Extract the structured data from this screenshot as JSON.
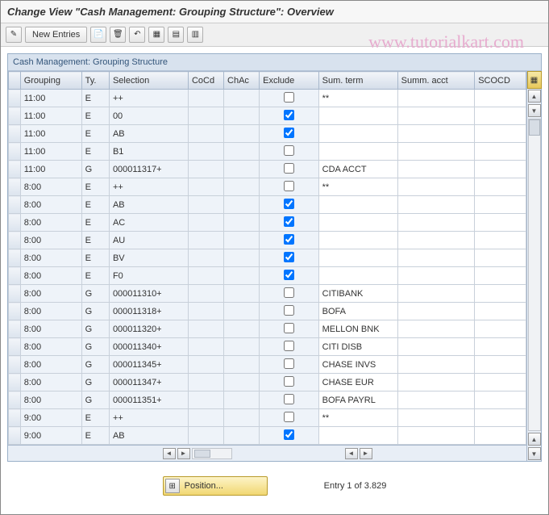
{
  "title": "Change View \"Cash Management: Grouping Structure\": Overview",
  "toolbar": {
    "new_entries_label": "New Entries"
  },
  "watermark": "www.tutorialkart.com",
  "panel_title": "Cash Management: Grouping Structure",
  "columns": {
    "grouping": "Grouping",
    "ty": "Ty.",
    "selection": "Selection",
    "cocd": "CoCd",
    "chac": "ChAc",
    "exclude": "Exclude",
    "sumterm": "Sum. term",
    "summacct": "Summ. acct",
    "scocd": "SCOCD"
  },
  "rows": [
    {
      "grouping": "11:00",
      "ty": "E",
      "selection": "++",
      "cocd": "",
      "chac": "",
      "exclude": false,
      "sumterm": "**",
      "summacct": "",
      "scocd": ""
    },
    {
      "grouping": "11:00",
      "ty": "E",
      "selection": "00",
      "cocd": "",
      "chac": "",
      "exclude": true,
      "sumterm": "",
      "summacct": "",
      "scocd": ""
    },
    {
      "grouping": "11:00",
      "ty": "E",
      "selection": "AB",
      "cocd": "",
      "chac": "",
      "exclude": true,
      "sumterm": "",
      "summacct": "",
      "scocd": ""
    },
    {
      "grouping": "11:00",
      "ty": "E",
      "selection": "B1",
      "cocd": "",
      "chac": "",
      "exclude": false,
      "sumterm": "",
      "summacct": "",
      "scocd": ""
    },
    {
      "grouping": "11:00",
      "ty": "G",
      "selection": "000011317+",
      "cocd": "",
      "chac": "",
      "exclude": false,
      "sumterm": "CDA ACCT",
      "summacct": "",
      "scocd": ""
    },
    {
      "grouping": "8:00",
      "ty": "E",
      "selection": "++",
      "cocd": "",
      "chac": "",
      "exclude": false,
      "sumterm": "**",
      "summacct": "",
      "scocd": ""
    },
    {
      "grouping": "8:00",
      "ty": "E",
      "selection": "AB",
      "cocd": "",
      "chac": "",
      "exclude": true,
      "sumterm": "",
      "summacct": "",
      "scocd": ""
    },
    {
      "grouping": "8:00",
      "ty": "E",
      "selection": "AC",
      "cocd": "",
      "chac": "",
      "exclude": true,
      "sumterm": "",
      "summacct": "",
      "scocd": ""
    },
    {
      "grouping": "8:00",
      "ty": "E",
      "selection": "AU",
      "cocd": "",
      "chac": "",
      "exclude": true,
      "sumterm": "",
      "summacct": "",
      "scocd": ""
    },
    {
      "grouping": "8:00",
      "ty": "E",
      "selection": "BV",
      "cocd": "",
      "chac": "",
      "exclude": true,
      "sumterm": "",
      "summacct": "",
      "scocd": ""
    },
    {
      "grouping": "8:00",
      "ty": "E",
      "selection": "F0",
      "cocd": "",
      "chac": "",
      "exclude": true,
      "sumterm": "",
      "summacct": "",
      "scocd": ""
    },
    {
      "grouping": "8:00",
      "ty": "G",
      "selection": "000011310+",
      "cocd": "",
      "chac": "",
      "exclude": false,
      "sumterm": "CITIBANK",
      "summacct": "",
      "scocd": ""
    },
    {
      "grouping": "8:00",
      "ty": "G",
      "selection": "000011318+",
      "cocd": "",
      "chac": "",
      "exclude": false,
      "sumterm": "BOFA",
      "summacct": "",
      "scocd": ""
    },
    {
      "grouping": "8:00",
      "ty": "G",
      "selection": "000011320+",
      "cocd": "",
      "chac": "",
      "exclude": false,
      "sumterm": "MELLON BNK",
      "summacct": "",
      "scocd": ""
    },
    {
      "grouping": "8:00",
      "ty": "G",
      "selection": "000011340+",
      "cocd": "",
      "chac": "",
      "exclude": false,
      "sumterm": "CITI DISB",
      "summacct": "",
      "scocd": ""
    },
    {
      "grouping": "8:00",
      "ty": "G",
      "selection": "000011345+",
      "cocd": "",
      "chac": "",
      "exclude": false,
      "sumterm": "CHASE INVS",
      "summacct": "",
      "scocd": ""
    },
    {
      "grouping": "8:00",
      "ty": "G",
      "selection": "000011347+",
      "cocd": "",
      "chac": "",
      "exclude": false,
      "sumterm": "CHASE EUR",
      "summacct": "",
      "scocd": ""
    },
    {
      "grouping": "8:00",
      "ty": "G",
      "selection": "000011351+",
      "cocd": "",
      "chac": "",
      "exclude": false,
      "sumterm": "BOFA PAYRL",
      "summacct": "",
      "scocd": ""
    },
    {
      "grouping": "9:00",
      "ty": "E",
      "selection": "++",
      "cocd": "",
      "chac": "",
      "exclude": false,
      "sumterm": "**",
      "summacct": "",
      "scocd": ""
    },
    {
      "grouping": "9:00",
      "ty": "E",
      "selection": "AB",
      "cocd": "",
      "chac": "",
      "exclude": true,
      "sumterm": "",
      "summacct": "",
      "scocd": ""
    }
  ],
  "footer": {
    "position_label": "Position...",
    "entry_text": "Entry 1 of 3.829"
  }
}
